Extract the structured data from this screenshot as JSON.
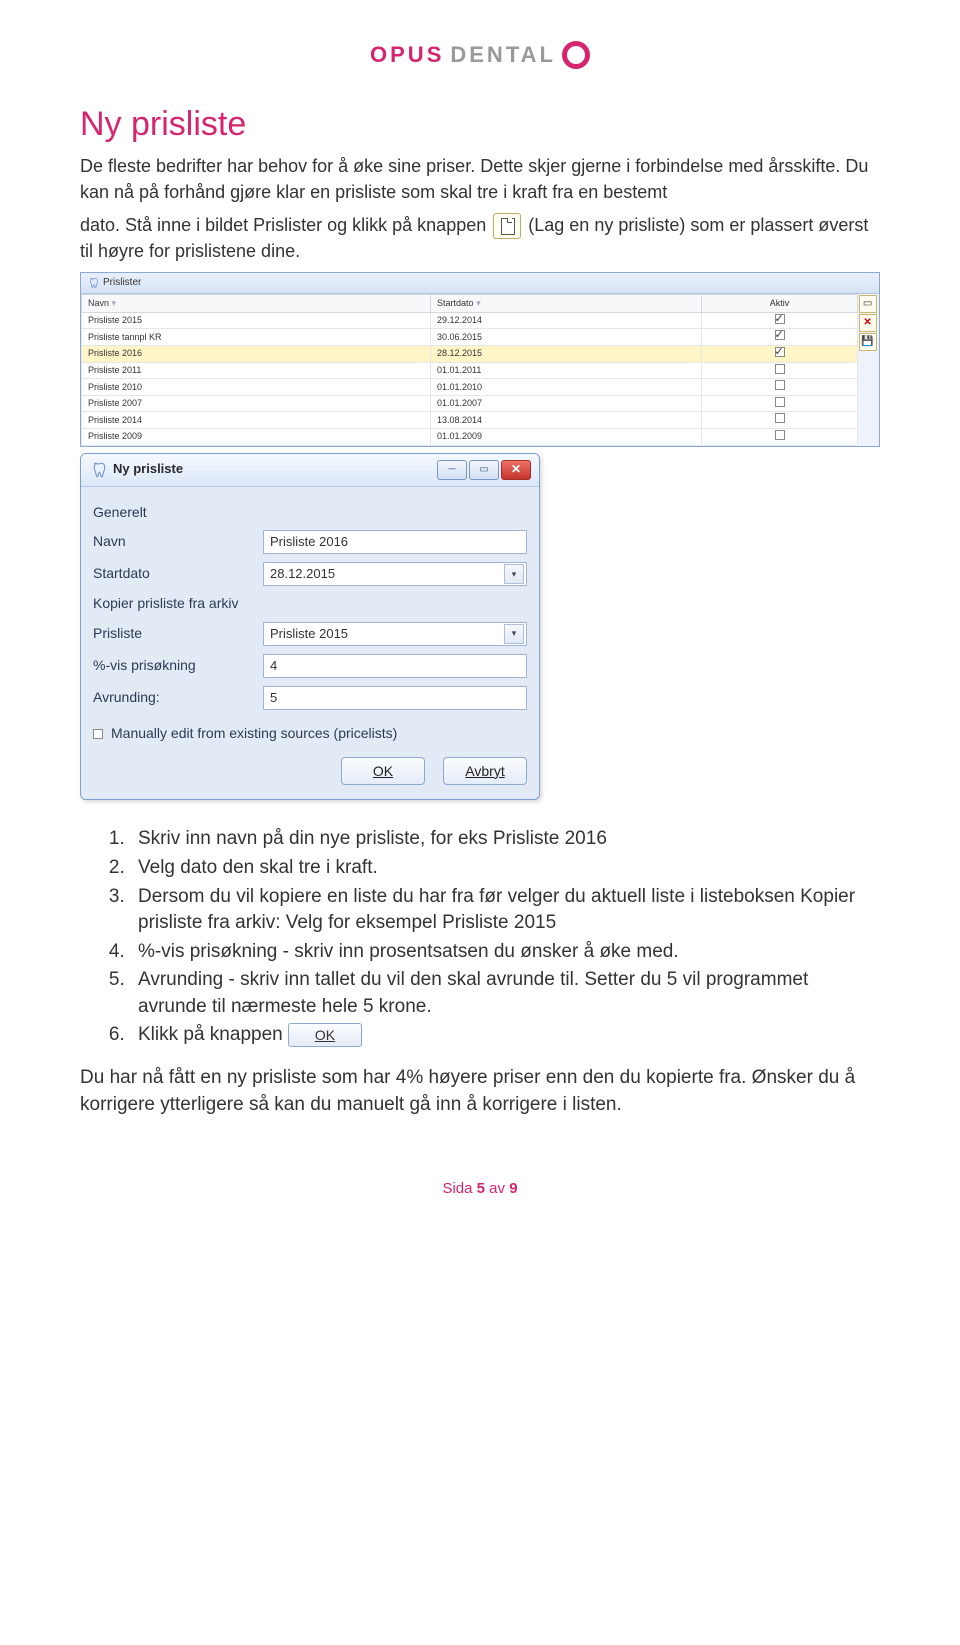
{
  "logo": {
    "brand1": "OPUS",
    "brand2": "DENTAL"
  },
  "heading": "Ny prisliste",
  "intro_p1": "De fleste bedrifter har behov for å øke sine priser. Dette skjer gjerne i forbindelse med årsskifte. Du kan nå på forhånd gjøre klar en prisliste som skal tre i kraft fra en bestemt",
  "intro_p2a": "dato. Stå inne i bildet Prislister og klikk på knappen",
  "intro_p2b": "(Lag en ny prisliste) som er plassert øverst til høyre for prislistene dine.",
  "prislister_table": {
    "title": "Prislister",
    "headers": {
      "navn": "Navn",
      "startdato": "Startdato",
      "aktiv": "Aktiv"
    },
    "rows": [
      {
        "navn": "Prisliste 2015",
        "dato": "29.12.2014",
        "aktiv": true,
        "hl": false
      },
      {
        "navn": "Prisliste tannpl KR",
        "dato": "30.06.2015",
        "aktiv": true,
        "hl": false
      },
      {
        "navn": "Prisliste 2016",
        "dato": "28.12.2015",
        "aktiv": true,
        "hl": true
      },
      {
        "navn": "Prisliste 2011",
        "dato": "01.01.2011",
        "aktiv": false,
        "hl": false
      },
      {
        "navn": "Prisliste 2010",
        "dato": "01.01.2010",
        "aktiv": false,
        "hl": false
      },
      {
        "navn": "Prisliste 2007",
        "dato": "01.01.2007",
        "aktiv": false,
        "hl": false
      },
      {
        "navn": "Prisliste 2014",
        "dato": "13.08.2014",
        "aktiv": false,
        "hl": false
      },
      {
        "navn": "Prisliste 2009",
        "dato": "01.01.2009",
        "aktiv": false,
        "hl": false
      }
    ]
  },
  "dialog": {
    "title": "Ny prisliste",
    "section_generelt": "Generelt",
    "lbl_navn": "Navn",
    "val_navn": "Prisliste 2016",
    "lbl_startdato": "Startdato",
    "val_startdato": "28.12.2015",
    "section_kopier": "Kopier prisliste fra arkiv",
    "lbl_prisliste": "Prisliste",
    "val_prisliste": "Prisliste 2015",
    "lbl_pris": "%-vis prisøkning",
    "val_pris": "4",
    "lbl_avrund": "Avrunding:",
    "val_avrund": "5",
    "lbl_manual": "Manually edit from existing sources (pricelists)",
    "btn_ok": "OK",
    "btn_cancel": "Avbryt"
  },
  "steps": {
    "s1": "Skriv inn navn på din nye prisliste, for eks Prisliste 2016",
    "s2": "Velg dato den skal tre i kraft.",
    "s3": "Dersom du vil kopiere en liste du har fra før velger du aktuell liste i listeboksen Kopier prisliste fra arkiv: Velg for eksempel Prisliste 2015",
    "s4": "%-vis prisøkning - skriv inn prosentsatsen du ønsker å øke med.",
    "s5": "Avrunding - skriv inn tallet du vil den skal avrunde til. Setter du 5 vil programmet avrunde til nærmeste hele 5 krone.",
    "s6": "Klikk på knappen",
    "s6_btn": "OK"
  },
  "outro": "Du har nå fått en ny prisliste som har 4% høyere priser enn den du kopierte fra. Ønsker du å korrigere ytterligere så kan du manuelt gå inn å korrigere i listen.",
  "page_footer": {
    "prefix": "Sida ",
    "current": "5",
    "mid": " av ",
    "total": "9"
  }
}
